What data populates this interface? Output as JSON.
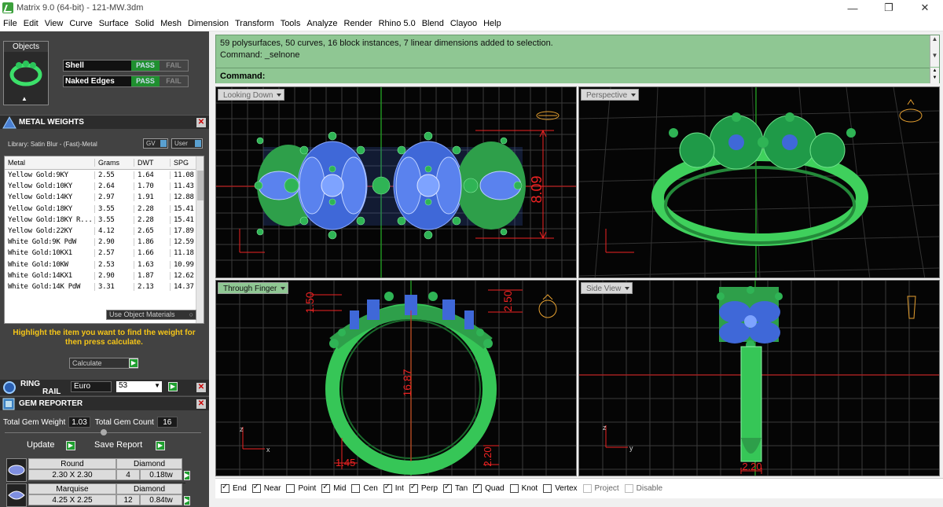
{
  "window": {
    "title": "Matrix 9.0 (64-bit) - 121-MW.3dm"
  },
  "menu": [
    "File",
    "Edit",
    "View",
    "Curve",
    "Surface",
    "Solid",
    "Mesh",
    "Dimension",
    "Transform",
    "Tools",
    "Analyze",
    "Render",
    "Rhino 5.0",
    "Blend",
    "Clayoo",
    "Help"
  ],
  "objects": {
    "title": "Objects"
  },
  "checks": [
    {
      "label": "Shell",
      "pass": "PASS",
      "fail": "FAIL"
    },
    {
      "label": "Naked Edges",
      "pass": "PASS",
      "fail": "FAIL"
    }
  ],
  "metal_weights": {
    "title": "METAL WEIGHTS",
    "library": "Library: Satin Blur - (Fast)-Metal",
    "gv": "GV",
    "user": "User",
    "columns": [
      "Metal",
      "Grams",
      "DWT",
      "SPG"
    ],
    "rows": [
      [
        "Yellow Gold:9KY",
        "2.55",
        "1.64",
        "11.08"
      ],
      [
        "Yellow Gold:10KY",
        "2.64",
        "1.70",
        "11.43"
      ],
      [
        "Yellow Gold:14KY",
        "2.97",
        "1.91",
        "12.88"
      ],
      [
        "Yellow Gold:18KY",
        "3.55",
        "2.28",
        "15.41"
      ],
      [
        "Yellow Gold:18KY R...",
        "3.55",
        "2.28",
        "15.41"
      ],
      [
        "Yellow Gold:22KY",
        "4.12",
        "2.65",
        "17.89"
      ],
      [
        "White Gold:9K PdW",
        "2.90",
        "1.86",
        "12.59"
      ],
      [
        "White Gold:10KX1",
        "2.57",
        "1.66",
        "11.18"
      ],
      [
        "White Gold:10KW",
        "2.53",
        "1.63",
        "10.99"
      ],
      [
        "White Gold:14KX1",
        "2.90",
        "1.87",
        "12.62"
      ],
      [
        "White Gold:14K PdW",
        "3.31",
        "2.13",
        "14.37"
      ]
    ],
    "use_object_materials": "Use Object Materials",
    "hint": "Highlight the item you want to find the weight for then press calculate.",
    "calculate": "Calculate"
  },
  "ring_rail": {
    "label1": "RING",
    "label2": "RAIL",
    "standard": "Euro",
    "size": "53"
  },
  "gem_reporter": {
    "title": "GEM REPORTER",
    "total_weight_label": "Total Gem Weight",
    "total_weight": "1.03",
    "total_count_label": "Total Gem Count",
    "total_count": "16",
    "update": "Update",
    "save_report": "Save Report",
    "gems": [
      {
        "shape": "Round",
        "size": "2.30 X 2.30",
        "material": "Diamond",
        "count": "4",
        "weight": "0.18tw"
      },
      {
        "shape": "Marquise",
        "size": "4.25 X 2.25",
        "material": "Diamond",
        "count": "12",
        "weight": "0.84tw"
      }
    ]
  },
  "command": {
    "line1": "59 polysurfaces, 50 curves, 16 block instances, 7 linear dimensions added to selection.",
    "line2": "Command: _selnone",
    "prompt": "Command:"
  },
  "viewports": {
    "top_left": {
      "name": "Looking Down",
      "dim": "8.09"
    },
    "top_right": {
      "name": "Perspective"
    },
    "bottom_left": {
      "name": "Through Finger",
      "dims": [
        "1.50",
        "2.50",
        "16.87",
        "1.45",
        "2.20"
      ]
    },
    "bottom_right": {
      "name": "Side View",
      "dim": "2.20"
    }
  },
  "axes": {
    "x": "x",
    "y": "y",
    "z": "z"
  },
  "osnaps": [
    {
      "label": "End",
      "on": true
    },
    {
      "label": "Near",
      "on": true
    },
    {
      "label": "Point",
      "on": false
    },
    {
      "label": "Mid",
      "on": true
    },
    {
      "label": "Cen",
      "on": false
    },
    {
      "label": "Int",
      "on": true
    },
    {
      "label": "Perp",
      "on": true
    },
    {
      "label": "Tan",
      "on": true
    },
    {
      "label": "Quad",
      "on": true
    },
    {
      "label": "Knot",
      "on": false
    },
    {
      "label": "Vertex",
      "on": false
    },
    {
      "label": "Project",
      "on": false,
      "dim": true
    },
    {
      "label": "Disable",
      "on": false,
      "dim": true
    }
  ]
}
